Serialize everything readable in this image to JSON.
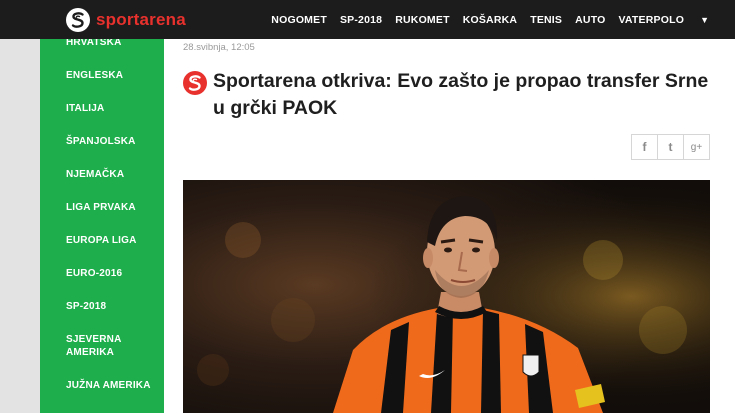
{
  "header": {
    "logo_text": "sportarena",
    "nav": [
      "NOGOMET",
      "SP-2018",
      "RUKOMET",
      "KOŠARKA",
      "TENIS",
      "AUTO",
      "VATERPOLO"
    ],
    "more_icon": "caret-down-icon"
  },
  "sidebar": {
    "items": [
      "HRVATSKA",
      "ENGLESKA",
      "ITALIJA",
      "ŠPANJOLSKA",
      "NJEMAČKA",
      "LIGA PRVAKA",
      "EUROPA LIGA",
      "EURO-2016",
      "SP-2018",
      "SJEVERNA AMERIKA",
      "JUŽNA AMERIKA"
    ]
  },
  "article": {
    "date": "28.svibnja, 12:05",
    "title": "Sportarena otkriva: Evo zašto je propao transfer Srne u grčki PAOK",
    "share": [
      "f",
      "t",
      "g+"
    ],
    "photo_alt_icon": "football-player-photo"
  },
  "colors": {
    "brand_red": "#e8312d",
    "sidebar_green": "#1eae4b",
    "topbar": "#1c1c1c"
  }
}
